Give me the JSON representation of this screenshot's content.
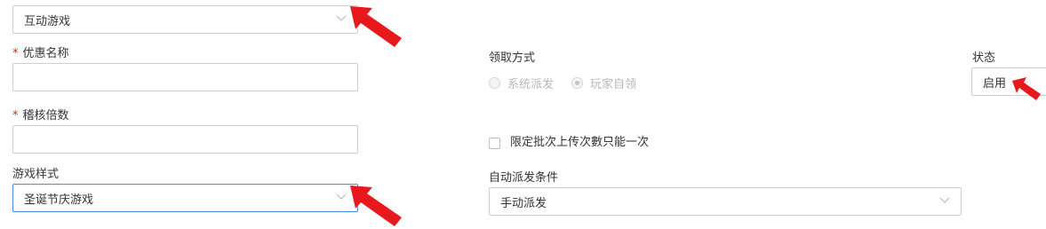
{
  "form": {
    "game_type": {
      "value": "互动游戏"
    },
    "discount_name": {
      "label": "优惠名称",
      "required_mark": "*",
      "value": ""
    },
    "audit_multiplier": {
      "label": "稽核倍数",
      "required_mark": "*",
      "value": ""
    },
    "game_style": {
      "label": "游戏样式",
      "value": "圣诞节庆游戏"
    },
    "claim_method": {
      "label": "领取方式",
      "options": [
        "系统派发",
        "玩家自领"
      ],
      "selected": "玩家自领"
    },
    "limit_once": {
      "label": "限定批次上传次數只能一次",
      "checked": false
    },
    "auto_dispatch": {
      "label": "自动派发条件",
      "value": "手动派发"
    },
    "status": {
      "label": "状态",
      "value": "启用"
    }
  },
  "annotations": {
    "arrow_color": "#e8191c"
  }
}
